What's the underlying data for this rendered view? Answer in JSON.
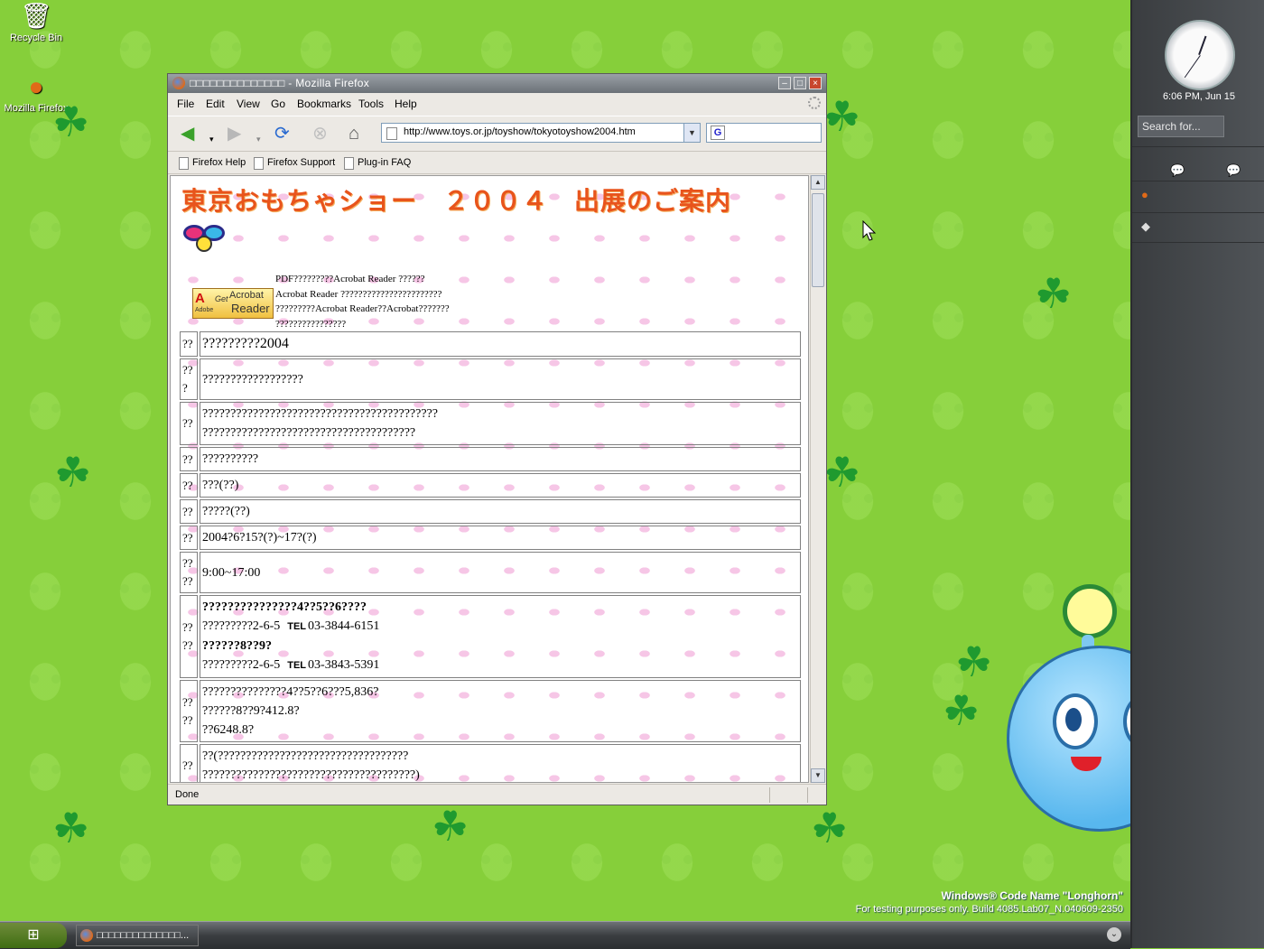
{
  "desktop": {
    "icons": [
      {
        "label": "Recycle Bin",
        "icon": "recycle-bin-icon"
      },
      {
        "label": "Mozilla Firefox",
        "icon": "firefox-icon"
      }
    ],
    "watermark": {
      "line1": "Windows® Code Name \"Longhorn\"",
      "line2": "For testing purposes only. Build 4085.Lab07_N.040609-2350"
    }
  },
  "sidebar": {
    "clock_text": "6:06 PM, Jun 15",
    "search_placeholder": "Search for...",
    "icons": [
      "chat-icon",
      "chat-icon",
      "firefox-icon",
      "tile-icon"
    ]
  },
  "taskbar": {
    "start_icon": "windows-logo-icon",
    "task_label": "□□□□□□□□□□□□□□..."
  },
  "window": {
    "title": "□□□□□□□□□□□□□□ - Mozilla Firefox",
    "menu": [
      "File",
      "Edit",
      "View",
      "Go",
      "Bookmarks",
      "Tools",
      "Help"
    ],
    "url": "http://www.toys.or.jp/toyshow/tokyotoyshow2004.htm",
    "bookmarks": [
      "Firefox Help",
      "Firefox Support",
      "Plug-in FAQ"
    ],
    "status": "Done"
  },
  "page": {
    "title": "東京おもちゃショー　２００４　出展のご案内",
    "acrobat": {
      "a": "A",
      "get": "Get",
      "line1": "Acrobat",
      "line2": "Reader",
      "brand": "Adobe"
    },
    "pdf_note": [
      "PDF?????????Acrobat Reader ??????",
      "Acrobat Reader ???????????????????????",
      "?????????Acrobat Reader??Acrobat???????",
      "????????????????"
    ],
    "rows": [
      {
        "k": "??",
        "v": [
          "?????????2004"
        ]
      },
      {
        "k": "??\n?",
        "v": [
          "??????????????????"
        ]
      },
      {
        "k": "??",
        "v": [
          "??????????????????????????????????????????",
          "??????????????????????????????????????"
        ]
      },
      {
        "k": "??",
        "v": [
          "??????????"
        ]
      },
      {
        "k": "??",
        "v": [
          "???(??)"
        ]
      },
      {
        "k": "??",
        "v": [
          "?????(??)"
        ]
      },
      {
        "k": "??",
        "v": [
          "2004?6?15?(?)~17?(?)"
        ]
      },
      {
        "k": "??\n??",
        "v": [
          "9:00~17:00"
        ]
      },
      {
        "k": "??\n??",
        "v": [
          "???????????????4??5??6????",
          "?????????2-6-5",
          "??????8??9?",
          "?????????2-6-5"
        ],
        "tel1": "03-3844-6151",
        "tel2": "03-3843-5391",
        "tel_label": "TEL"
      },
      {
        "k": "??\n??",
        "v": [
          "???????????????4??5??6???5,836?",
          "??????8??9?412.8?",
          "??6248.8?"
        ]
      },
      {
        "k": "??",
        "v": [
          "??(??????????????????????????????????",
          "??????????????????????????????????????)"
        ]
      }
    ]
  }
}
